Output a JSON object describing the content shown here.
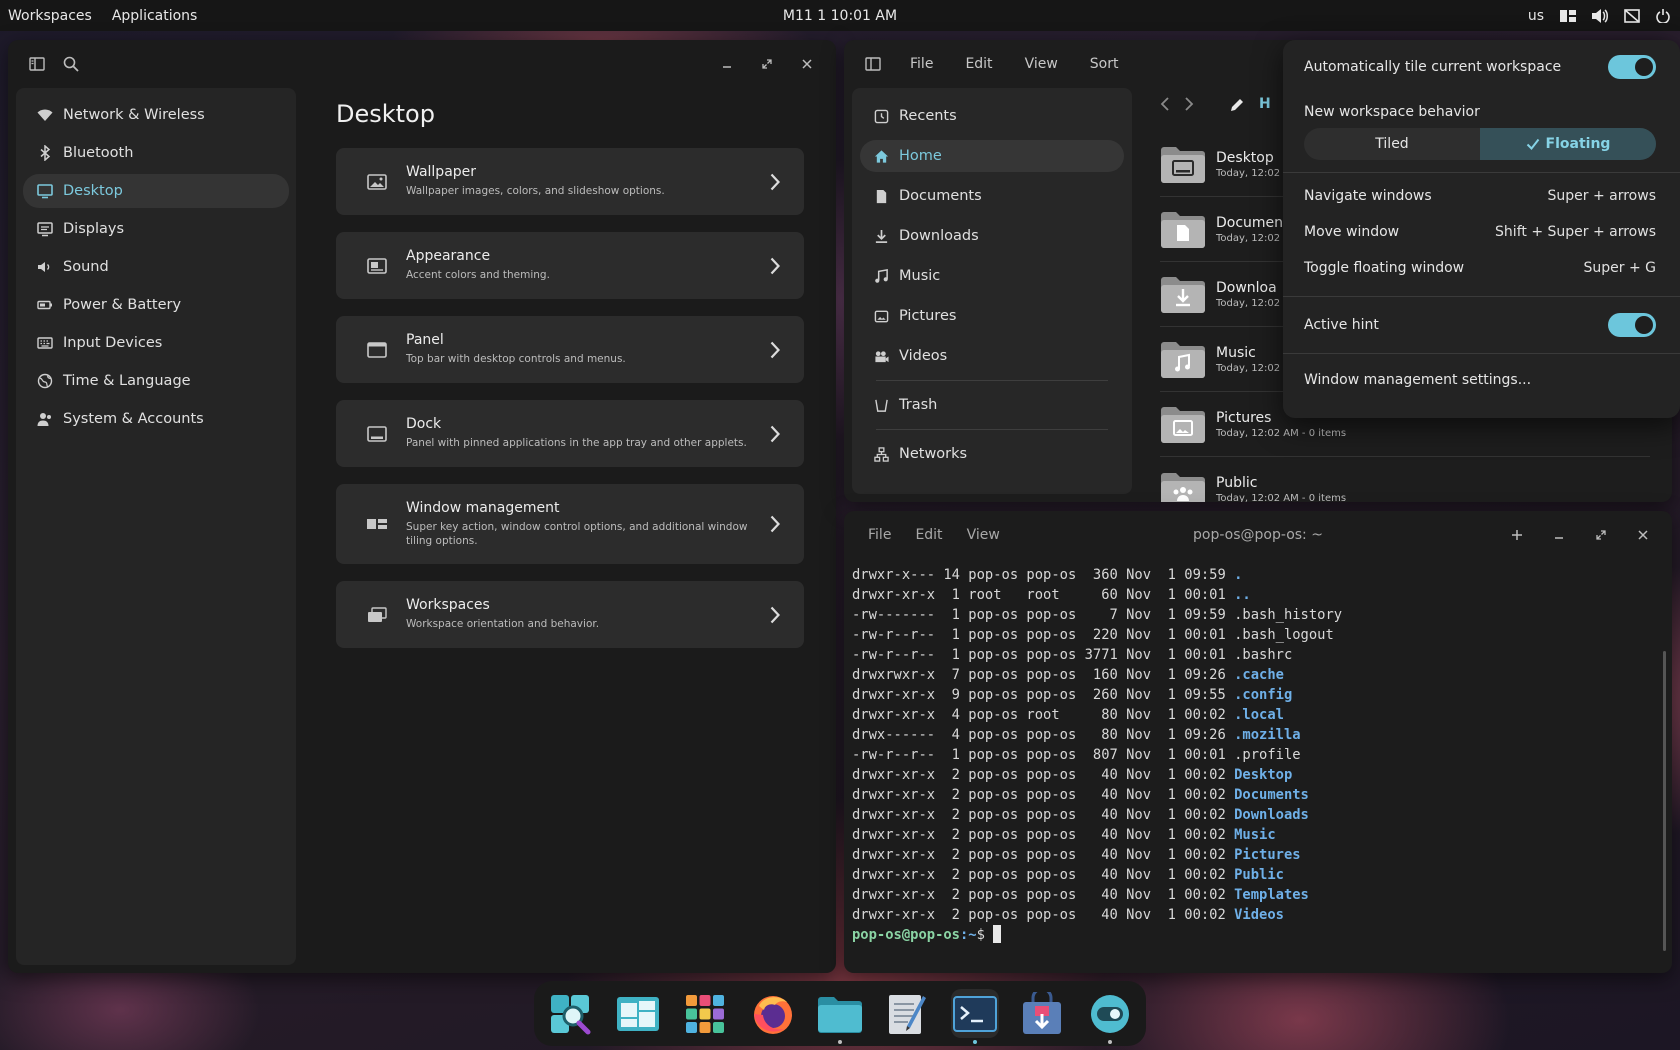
{
  "top_panel": {
    "workspaces": "Workspaces",
    "applications": "Applications",
    "clock": "M11 1 10:01 AM",
    "keyboard_layout": "us"
  },
  "settings": {
    "sidebar": [
      {
        "label": "Network & Wireless",
        "icon": "wifi-icon"
      },
      {
        "label": "Bluetooth",
        "icon": "bluetooth-icon"
      },
      {
        "label": "Desktop",
        "icon": "monitor-icon",
        "active": true
      },
      {
        "label": "Displays",
        "icon": "display-icon"
      },
      {
        "label": "Sound",
        "icon": "speaker-icon"
      },
      {
        "label": "Power & Battery",
        "icon": "battery-icon"
      },
      {
        "label": "Input Devices",
        "icon": "keyboard-icon"
      },
      {
        "label": "Time & Language",
        "icon": "globe-icon"
      },
      {
        "label": "System & Accounts",
        "icon": "users-icon"
      }
    ],
    "page_title": "Desktop",
    "cards": [
      {
        "title": "Wallpaper",
        "desc": "Wallpaper images, colors, and slideshow options."
      },
      {
        "title": "Appearance",
        "desc": "Accent colors and theming."
      },
      {
        "title": "Panel",
        "desc": "Top bar with desktop controls and menus."
      },
      {
        "title": "Dock",
        "desc": "Panel with pinned applications in the app tray and other applets."
      },
      {
        "title": "Window management",
        "desc": "Super key action, window control options, and additional window tiling options."
      },
      {
        "title": "Workspaces",
        "desc": "Workspace orientation and behavior."
      }
    ]
  },
  "files": {
    "menu": [
      "File",
      "Edit",
      "View",
      "Sort"
    ],
    "sidebar": [
      {
        "label": "Recents",
        "icon": "clock-icon"
      },
      {
        "label": "Home",
        "icon": "home-icon",
        "active": true
      },
      {
        "label": "Documents",
        "icon": "document-icon"
      },
      {
        "label": "Downloads",
        "icon": "download-icon"
      },
      {
        "label": "Music",
        "icon": "music-icon"
      },
      {
        "label": "Pictures",
        "icon": "image-icon"
      },
      {
        "label": "Videos",
        "icon": "video-icon"
      }
    ],
    "trash": "Trash",
    "networks": "Networks",
    "crumb": "H",
    "items": [
      {
        "name": "Desktop",
        "meta": "Today, 12:02 A",
        "icon": "desktop-folder-icon"
      },
      {
        "name": "Documen",
        "meta": "Today, 12:02 A",
        "icon": "documents-folder-icon"
      },
      {
        "name": "Downloa",
        "meta": "Today, 12:02 A",
        "icon": "downloads-folder-icon"
      },
      {
        "name": "Music",
        "meta": "Today, 12:02 A",
        "icon": "music-folder-icon"
      },
      {
        "name": "Pictures",
        "meta": "Today, 12:02 AM - 0 items",
        "icon": "pictures-folder-icon"
      },
      {
        "name": "Public",
        "meta": "Today, 12:02 AM - 0 items",
        "icon": "public-folder-icon"
      }
    ]
  },
  "popup": {
    "auto_tile": "Automatically tile current workspace",
    "new_ws_behavior": "New workspace behavior",
    "tiled": "Tiled",
    "floating": "Floating",
    "shortcuts": [
      {
        "label": "Navigate windows",
        "keys": "Super + arrows"
      },
      {
        "label": "Move window",
        "keys": "Shift + Super + arrows"
      },
      {
        "label": "Toggle floating window",
        "keys": "Super + G"
      }
    ],
    "active_hint": "Active hint",
    "wm_settings": "Window management settings..."
  },
  "terminal": {
    "menu": [
      "File",
      "Edit",
      "View"
    ],
    "title": "pop-os@pop-os: ~",
    "lines": [
      {
        "prefix": "drwxr-x--- 14 pop-os pop-os  360 Nov  1 09:59 ",
        "name": ".",
        "dir": true
      },
      {
        "prefix": "drwxr-xr-x  1 root   root     60 Nov  1 00:01 ",
        "name": "..",
        "dir": true
      },
      {
        "prefix": "-rw-------  1 pop-os pop-os    7 Nov  1 09:59 ",
        "name": ".bash_history",
        "dir": false
      },
      {
        "prefix": "-rw-r--r--  1 pop-os pop-os  220 Nov  1 00:01 ",
        "name": ".bash_logout",
        "dir": false
      },
      {
        "prefix": "-rw-r--r--  1 pop-os pop-os 3771 Nov  1 00:01 ",
        "name": ".bashrc",
        "dir": false
      },
      {
        "prefix": "drwxrwxr-x  7 pop-os pop-os  160 Nov  1 09:26 ",
        "name": ".cache",
        "dir": true
      },
      {
        "prefix": "drwxr-xr-x  9 pop-os pop-os  260 Nov  1 09:55 ",
        "name": ".config",
        "dir": true
      },
      {
        "prefix": "drwxr-xr-x  4 pop-os root     80 Nov  1 00:02 ",
        "name": ".local",
        "dir": true
      },
      {
        "prefix": "drwx------  4 pop-os pop-os   80 Nov  1 09:26 ",
        "name": ".mozilla",
        "dir": true
      },
      {
        "prefix": "-rw-r--r--  1 pop-os pop-os  807 Nov  1 00:01 ",
        "name": ".profile",
        "dir": false
      },
      {
        "prefix": "drwxr-xr-x  2 pop-os pop-os   40 Nov  1 00:02 ",
        "name": "Desktop",
        "dir": true
      },
      {
        "prefix": "drwxr-xr-x  2 pop-os pop-os   40 Nov  1 00:02 ",
        "name": "Documents",
        "dir": true
      },
      {
        "prefix": "drwxr-xr-x  2 pop-os pop-os   40 Nov  1 00:02 ",
        "name": "Downloads",
        "dir": true
      },
      {
        "prefix": "drwxr-xr-x  2 pop-os pop-os   40 Nov  1 00:02 ",
        "name": "Music",
        "dir": true
      },
      {
        "prefix": "drwxr-xr-x  2 pop-os pop-os   40 Nov  1 00:02 ",
        "name": "Pictures",
        "dir": true
      },
      {
        "prefix": "drwxr-xr-x  2 pop-os pop-os   40 Nov  1 00:02 ",
        "name": "Public",
        "dir": true
      },
      {
        "prefix": "drwxr-xr-x  2 pop-os pop-os   40 Nov  1 00:02 ",
        "name": "Templates",
        "dir": true
      },
      {
        "prefix": "drwxr-xr-x  2 pop-os pop-os   40 Nov  1 00:02 ",
        "name": "Videos",
        "dir": true
      }
    ],
    "prompt_user": "pop-os@pop-os",
    "prompt_path": ":~",
    "prompt_end": "$ "
  },
  "dock": [
    {
      "name": "app-search-icon",
      "active": false,
      "dot": false
    },
    {
      "name": "workspaces-icon",
      "active": false,
      "dot": false
    },
    {
      "name": "app-library-icon",
      "active": false,
      "dot": false
    },
    {
      "name": "firefox-icon",
      "active": false,
      "dot": false
    },
    {
      "name": "files-icon",
      "active": false,
      "dot": true
    },
    {
      "name": "text-editor-icon",
      "active": false,
      "dot": false
    },
    {
      "name": "terminal-icon",
      "active": true,
      "dot": true
    },
    {
      "name": "store-icon",
      "active": false,
      "dot": false
    },
    {
      "name": "settings-icon",
      "active": false,
      "dot": true
    }
  ],
  "colors": {
    "accent": "#6cc6dc",
    "active_text": "#7cc9dd"
  }
}
